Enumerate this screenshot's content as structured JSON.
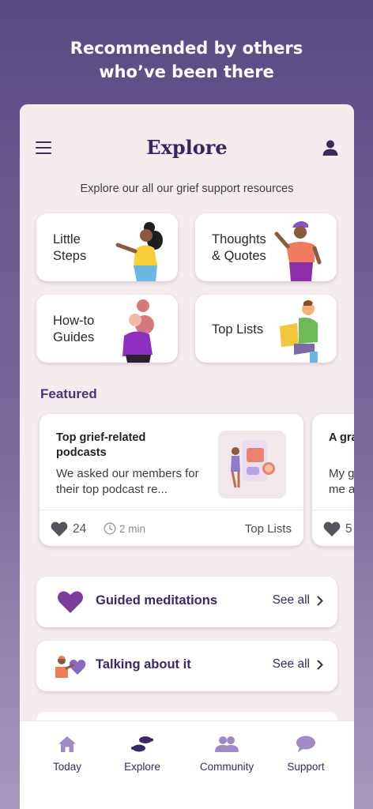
{
  "headline": {
    "line1": "Recommended by others",
    "line2": "who’ve been there"
  },
  "header": {
    "title": "Explore"
  },
  "subtitle": "Explore our all our grief support resources",
  "categories": [
    {
      "label": "Little\nSteps"
    },
    {
      "label": "Thoughts\n& Quotes"
    },
    {
      "label": "How-to\nGuides"
    },
    {
      "label": "Top Lists"
    }
  ],
  "featured": {
    "title": "Featured",
    "cards": [
      {
        "title": "Top grief-related podcasts",
        "description": "We asked our members for their top podcast re...",
        "likes": "24",
        "time": "2 min",
        "tag": "Top Lists"
      },
      {
        "title": "A gra",
        "description": "My g me a",
        "likes": "5"
      }
    ]
  },
  "sections": [
    {
      "label": "Guided meditations",
      "action": "See all"
    },
    {
      "label": "Talking about it",
      "action": "See all"
    }
  ],
  "tabs": [
    {
      "label": "Today"
    },
    {
      "label": "Explore"
    },
    {
      "label": "Community"
    },
    {
      "label": "Support"
    }
  ],
  "colors": {
    "accent": "#3b2864",
    "heart": "#7a3d9a",
    "background_top": "#5a4a83"
  }
}
